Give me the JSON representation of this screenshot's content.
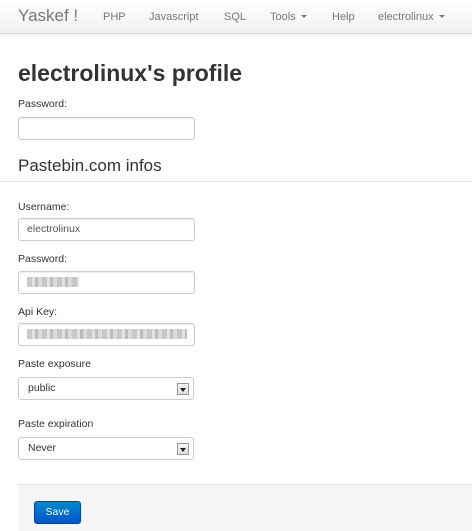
{
  "navbar": {
    "brand": "Yaskef !",
    "items": [
      {
        "label": "PHP"
      },
      {
        "label": "Javascript"
      },
      {
        "label": "SQL"
      },
      {
        "label": "Tools",
        "dropdown": true
      },
      {
        "label": "Help"
      },
      {
        "label": "electrolinux",
        "dropdown": true
      }
    ]
  },
  "page": {
    "title": "electrolinux's profile"
  },
  "form": {
    "password_label": "Password:",
    "password_value": "",
    "pastebin_legend": "Pastebin.com infos",
    "username_label": "Username:",
    "username_value": "electrolinux",
    "pastebin_password_label": "Password:",
    "api_key_label": "Api Key:",
    "paste_exposure_label": "Paste exposure",
    "paste_exposure_value": "public",
    "paste_expiration_label": "Paste expiration",
    "paste_expiration_value": "Never",
    "save_label": "Save"
  },
  "icons": {
    "dropdown": "caret-down-icon",
    "select": "select-arrow-icon"
  },
  "colors": {
    "primary_button": "#0066cc",
    "navbar_bg": "#f5f5f5",
    "form_actions_bg": "#f5f5f5"
  }
}
